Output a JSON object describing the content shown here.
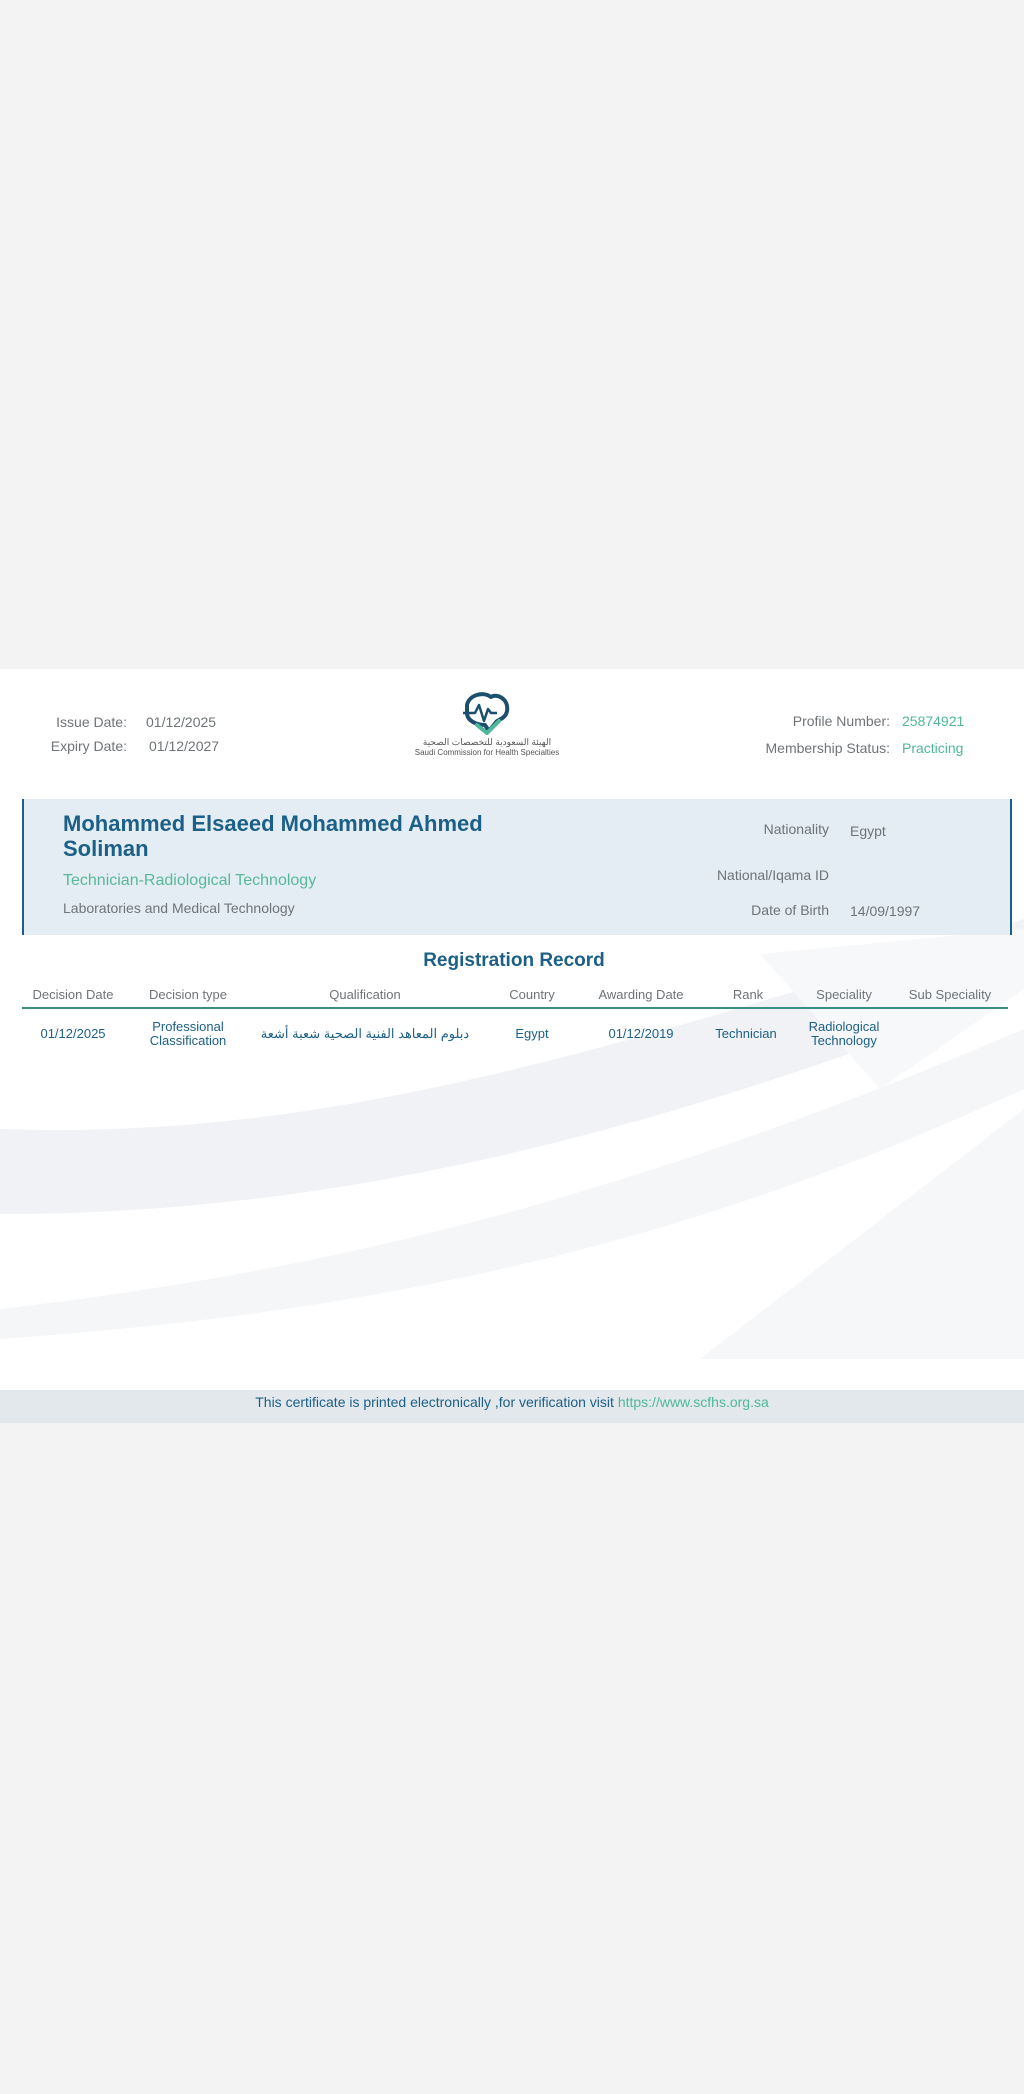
{
  "header": {
    "issue_date_label": "Issue Date:",
    "issue_date": "01/12/2025",
    "expiry_date_label": "Expiry Date:",
    "expiry_date": "01/12/2027",
    "profile_number_label": "Profile Number:",
    "profile_number": "25874921",
    "membership_status_label": "Membership Status:",
    "membership_status": "Practicing"
  },
  "logo": {
    "arabic": "الهيئة السعودية للتخصصات الصحية",
    "english": "Saudi Commission for Health Specialties"
  },
  "person": {
    "name": "Mohammed Elsaeed Mohammed Ahmed Soliman",
    "title": "Technician-Radiological Technology",
    "category": "Laboratories and Medical Technology",
    "nationality_label": "Nationality",
    "nationality": "Egypt",
    "national_id_label": "National/Iqama ID",
    "national_id": "",
    "dob_label": "Date of Birth",
    "dob": "14/09/1997"
  },
  "registration": {
    "title": "Registration Record",
    "columns": [
      "Decision Date",
      "Decision type",
      "Qualification",
      "Country",
      "Awarding Date",
      "Rank",
      "Speciality",
      "Sub Speciality"
    ],
    "rows": [
      [
        "01/12/2025",
        "Professional Classification",
        "دبلوم المعاهد الفنية الصحية شعبة أشعة",
        "Egypt",
        "01/12/2019",
        "Technician",
        "Radiological Technology",
        ""
      ]
    ]
  },
  "footer": {
    "text": "This certificate is printed electronically ,for verification visit",
    "link": "https://www.scfhs.org.sa"
  },
  "colors": {
    "primary": "#1c5f87",
    "accent": "#4fb89a",
    "band": "#e3edf3"
  }
}
